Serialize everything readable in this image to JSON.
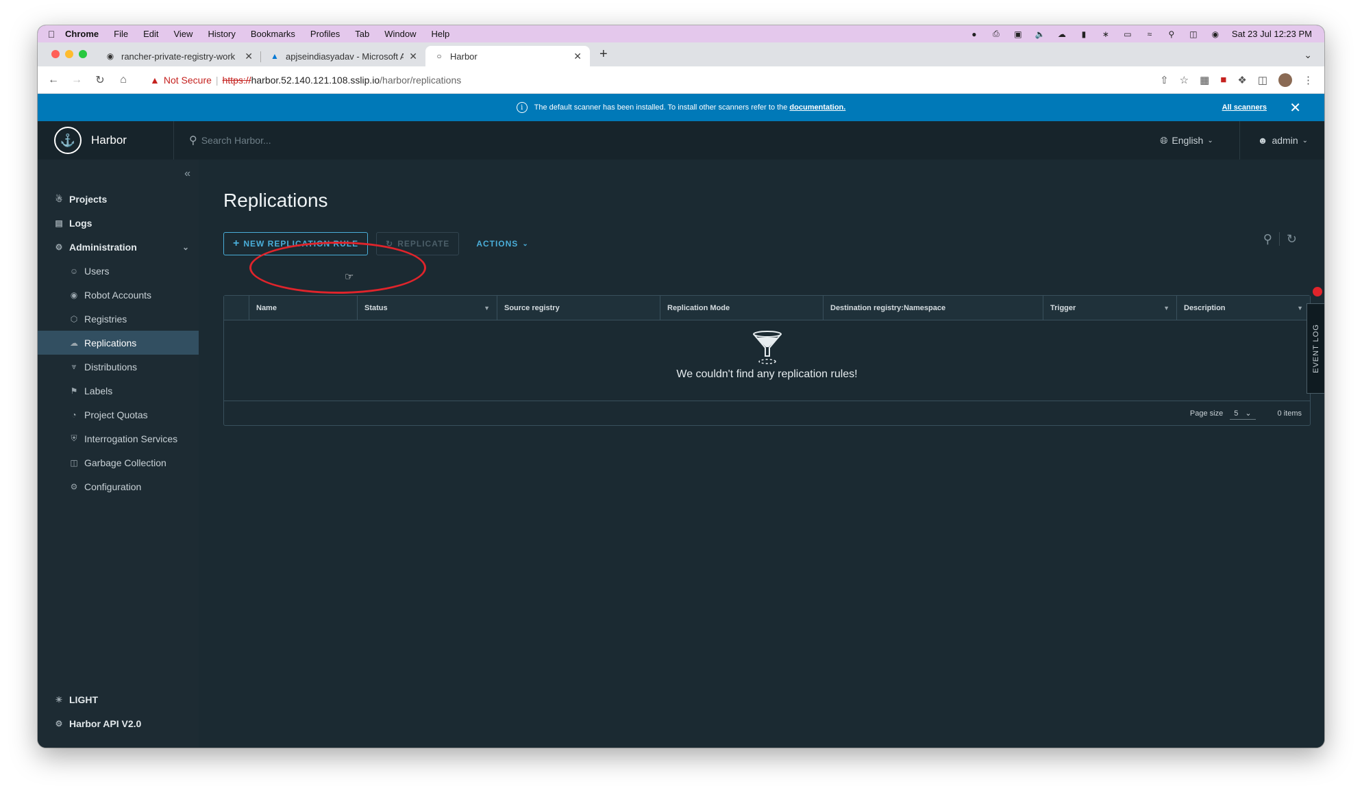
{
  "menubar": {
    "app": "Chrome",
    "items": [
      "File",
      "Edit",
      "View",
      "History",
      "Bookmarks",
      "Profiles",
      "Tab",
      "Window",
      "Help"
    ],
    "datetime": "Sat 23 Jul  12:23 PM"
  },
  "tabs": [
    {
      "title": "rancher-private-registry-work",
      "icon": "github-icon"
    },
    {
      "title": "apjseindiasyadav - Microsoft A",
      "icon": "azure-icon"
    },
    {
      "title": "Harbor",
      "icon": "globe-icon"
    }
  ],
  "address": {
    "security": "Not Secure",
    "scheme": "https://",
    "host": "harbor.52.140.121.108.sslip.io",
    "path": "/harbor/replications"
  },
  "banner": {
    "message": "The default scanner has been installed. To install other scanners refer to the",
    "link": "documentation.",
    "all_scanners": "All scanners"
  },
  "header": {
    "brand": "Harbor",
    "search_placeholder": "Search Harbor...",
    "language": "English",
    "user": "admin"
  },
  "sidebar": {
    "items": [
      {
        "label": "Projects",
        "icon": "projects-icon",
        "level": "top"
      },
      {
        "label": "Logs",
        "icon": "logs-icon",
        "level": "top"
      },
      {
        "label": "Administration",
        "icon": "admin-icon",
        "level": "top"
      },
      {
        "label": "Users",
        "icon": "users-icon",
        "level": "sub"
      },
      {
        "label": "Robot Accounts",
        "icon": "robot-icon",
        "level": "sub"
      },
      {
        "label": "Registries",
        "icon": "registries-icon",
        "level": "sub"
      },
      {
        "label": "Replications",
        "icon": "replications-icon",
        "level": "sub",
        "active": true
      },
      {
        "label": "Distributions",
        "icon": "distributions-icon",
        "level": "sub"
      },
      {
        "label": "Labels",
        "icon": "labels-icon",
        "level": "sub"
      },
      {
        "label": "Project Quotas",
        "icon": "quotas-icon",
        "level": "sub"
      },
      {
        "label": "Interrogation Services",
        "icon": "shield-icon",
        "level": "sub"
      },
      {
        "label": "Garbage Collection",
        "icon": "trash-icon",
        "level": "sub"
      },
      {
        "label": "Configuration",
        "icon": "gear-icon",
        "level": "sub"
      }
    ],
    "footer": [
      {
        "label": "LIGHT",
        "icon": "sun-icon"
      },
      {
        "label": "Harbor API V2.0",
        "icon": "api-icon"
      }
    ]
  },
  "main": {
    "title": "Replications",
    "new_rule": "NEW REPLICATION RULE",
    "replicate": "REPLICATE",
    "actions": "ACTIONS",
    "columns": [
      {
        "label": "Name",
        "filter": false
      },
      {
        "label": "Status",
        "filter": true
      },
      {
        "label": "Source registry",
        "filter": false
      },
      {
        "label": "Replication Mode",
        "filter": false
      },
      {
        "label": "Destination registry:Namespace",
        "filter": false
      },
      {
        "label": "Trigger",
        "filter": true
      },
      {
        "label": "Description",
        "filter": true
      }
    ],
    "empty_message": "We couldn't find any replication rules!",
    "page_size_label": "Page size",
    "page_size": "5",
    "items_count": "0 items",
    "event_log": "EVENT LOG"
  },
  "colors": {
    "banner": "#0079b8",
    "accent": "#4aaed9",
    "highlight": "#e0242b",
    "background": "#1b2a32"
  }
}
